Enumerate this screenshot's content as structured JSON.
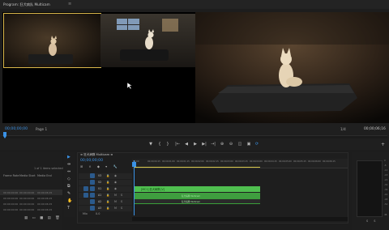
{
  "monitor": {
    "title": "Program: 狂犬病队 Multicam",
    "title_menu": "≡",
    "tc_left": "00;00;00;00",
    "page_select": "Page 1",
    "zoom": "1/4",
    "tc_right": "00;00;06;16"
  },
  "transport": {
    "buttons": [
      "▼",
      "{",
      "}",
      "|←",
      "◀",
      "▶",
      "▶|",
      "→|",
      "⊕",
      "⊖",
      "◫",
      "▣",
      "⟳"
    ],
    "plus": "+"
  },
  "project": {
    "items_selected": "1 of 1 items selected",
    "columns": [
      "Frame Rate",
      "Media Start",
      "Media End"
    ],
    "rows": [
      {
        "name": "00:00:00:00",
        "start": "00:00:00:00",
        "end": "00:00:06:15"
      },
      {
        "name": "00:00:00:00",
        "start": "00:00:00:00",
        "end": "00:00:06:15"
      },
      {
        "name": "00:00:00:00",
        "start": "00:00:00:00",
        "end": "00:00:06:15"
      },
      {
        "name": "00:00:00:00",
        "start": "00:00:00:00",
        "end": "00:00:06:15"
      }
    ],
    "tools": "▦ ▭ ■ ▤ 🗑"
  },
  "tools": [
    "▶",
    "⇹",
    "⇔",
    "◇",
    "⧉",
    "✎",
    "✋",
    "T"
  ],
  "sequence": {
    "tab": "≡ 狂犬病隊 Multicam ≡",
    "timecode": "00;00;00;00",
    "ruler": [
      "00;00",
      "00;00;00;15",
      "00;00;01;00",
      "00;00;01;15",
      "00;00;02;00",
      "00;00;02;15",
      "00;00;03;00",
      "00;00;03;15",
      "00;00;04;00",
      "00;00;04;15",
      "00;00;05;00",
      "00;00;05;15",
      "00;00;06;00",
      "00;00;06;15"
    ],
    "tracks": [
      {
        "name": "V3",
        "label": "V3"
      },
      {
        "name": "V2",
        "label": "V2"
      },
      {
        "name": "V1",
        "label": "V1"
      },
      {
        "name": "A1",
        "label": "A1"
      },
      {
        "name": "A2",
        "label": "A2"
      },
      {
        "name": "A3",
        "label": "A3"
      }
    ],
    "clip_v1": "[MC1] 狂犬病隊 [V]",
    "clip_a1": "狂犬病隊 Multicam",
    "clip_a2": "狂犬病隊 Multicam",
    "mix_label": "Mix",
    "mix_value": "0.0"
  },
  "meters": {
    "scale": [
      "0",
      "-6",
      "-12",
      "-18",
      "-24",
      "-30",
      "-36",
      "-42",
      "-48",
      "-54",
      "dB"
    ],
    "solo": "S S"
  }
}
